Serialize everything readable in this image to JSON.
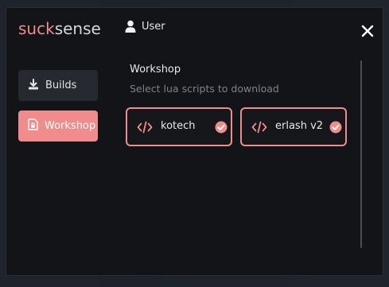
{
  "app": {
    "brand_a": "suck",
    "brand_b": "sense",
    "user_label": "User"
  },
  "nav": {
    "builds_label": "Builds",
    "workshop_label": "Workshop"
  },
  "workshop": {
    "title": "Workshop",
    "subtitle": "Select lua scripts to download",
    "scripts": [
      {
        "name": "kotech",
        "selected": true
      },
      {
        "name": "erlash v2",
        "selected": true
      }
    ]
  },
  "colors": {
    "accent": "#f08c8c",
    "window_bg": "#121417",
    "nav_inactive_bg": "#262a30"
  },
  "icons": {
    "user": "user-icon",
    "close": "close-icon",
    "builds": "download-icon",
    "workshop": "file-lock-icon",
    "script": "code-icon",
    "selected": "check-circle-icon"
  }
}
